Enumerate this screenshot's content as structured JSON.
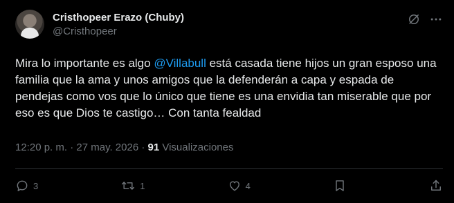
{
  "tweet": {
    "author": {
      "display_name": "Cristhopeer Erazo (Chuby)",
      "handle": "@Cristhopeer"
    },
    "body": {
      "part1": "Mira lo importante es algo ",
      "mention": "@Villabull",
      "part2": " está casada tiene hijos un gran esposo una familia que la ama y unos amigos que la defenderán a capa y espada de pendejas como vos que lo único que tiene es una envidia tan miserable que por eso es que Dios te castigo… Con tanta fealdad"
    },
    "meta": {
      "time": "12:20 p. m.",
      "separator1": " · ",
      "date": "27 may. 2026",
      "separator2": " · ",
      "views": "91",
      "views_label": " Visualizaciones"
    },
    "actions": {
      "replies": "3",
      "retweets": "1",
      "likes": "4"
    },
    "icons": {
      "grok": "grok-icon",
      "more": "more-icon",
      "reply": "reply-icon",
      "retweet": "retweet-icon",
      "like": "like-icon",
      "bookmark": "bookmark-icon",
      "share": "share-icon"
    },
    "colors": {
      "background": "#000000",
      "text": "#e7e9ea",
      "muted": "#71767b",
      "mention": "#1d9bf0",
      "divider": "#2f3336"
    }
  }
}
